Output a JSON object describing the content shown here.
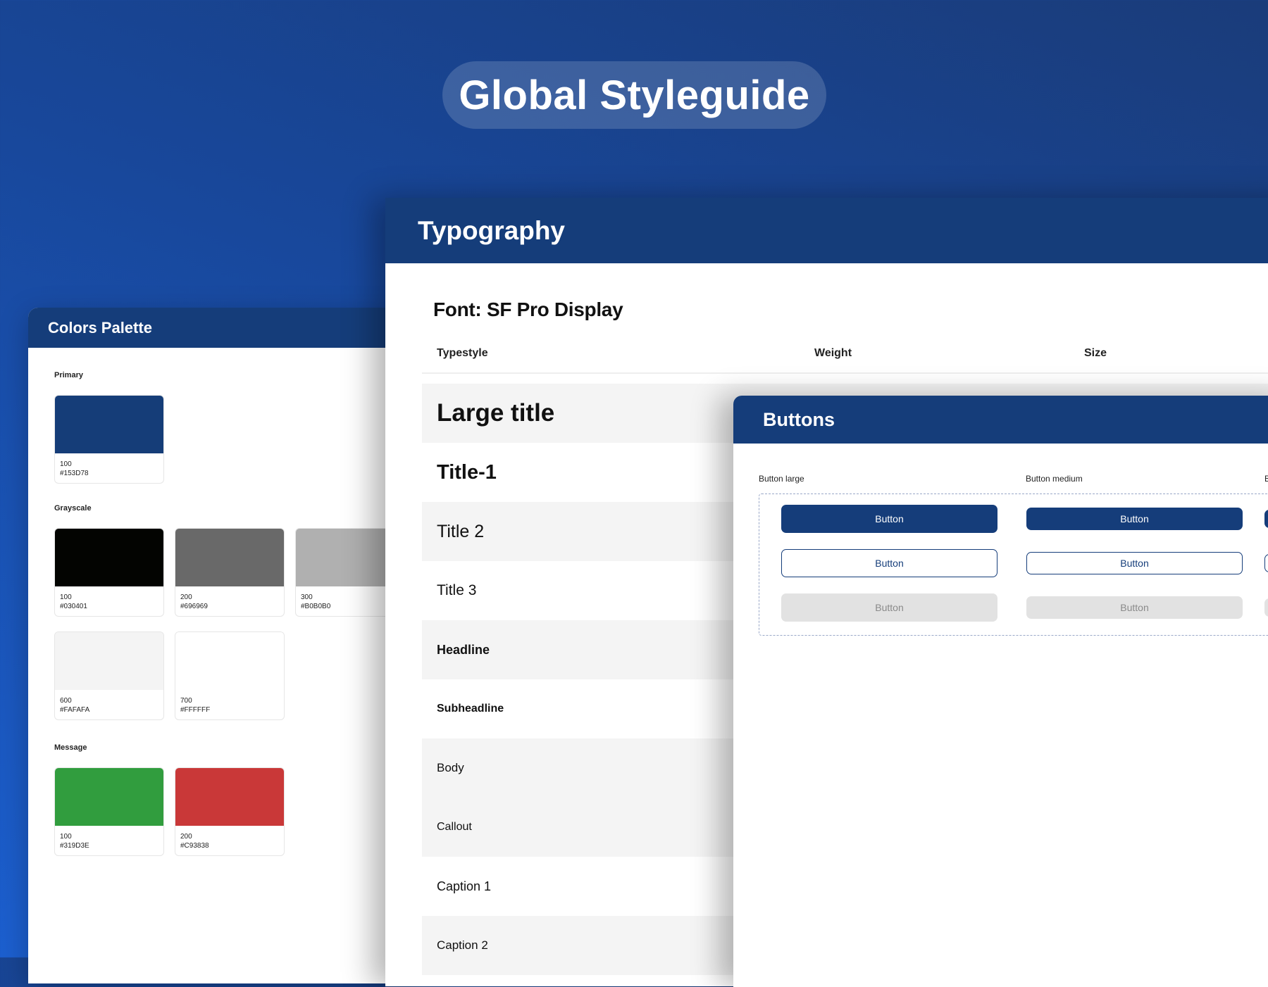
{
  "page": {
    "title": "Global Styleguide"
  },
  "colors": {
    "title": "Colors Palette",
    "groups": [
      {
        "label": "Primary",
        "swatches": [
          {
            "level": "100",
            "hex": "#153D78",
            "color": "#153d78"
          }
        ]
      },
      {
        "label": "Grayscale",
        "swatches": [
          {
            "level": "100",
            "hex": "#030401",
            "color": "#030401"
          },
          {
            "level": "200",
            "hex": "#696969",
            "color": "#696969"
          },
          {
            "level": "300",
            "hex": "#B0B0B0",
            "color": "#b0b0b0"
          },
          {
            "level": "600",
            "hex": "#FAFAFA",
            "color": "#f4f4f4"
          },
          {
            "level": "700",
            "hex": "#FFFFFF",
            "color": "#ffffff"
          }
        ]
      },
      {
        "label": "Message",
        "swatches": [
          {
            "level": "100",
            "hex": "#319D3E",
            "color": "#319d3e"
          },
          {
            "level": "200",
            "hex": "#C93838",
            "color": "#c93838"
          }
        ]
      }
    ]
  },
  "typography": {
    "title": "Typography",
    "font": "Font: SF Pro Display",
    "columns": [
      "Typestyle",
      "Weight",
      "Size"
    ],
    "styles": [
      "Large title",
      "Title-1",
      "Title 2",
      "Title 3",
      "Headline",
      "Subheadline",
      "Body",
      "Callout",
      "Caption 1",
      "Caption 2"
    ]
  },
  "buttons": {
    "title": "Buttons",
    "groups": [
      {
        "label": "Button large"
      },
      {
        "label": "Button medium"
      },
      {
        "label": "B"
      }
    ],
    "button_label": "Button"
  },
  "theme": {
    "brand": "#153D7A",
    "background_start": "#1a3c7a",
    "background_end": "#1c5fcf"
  }
}
